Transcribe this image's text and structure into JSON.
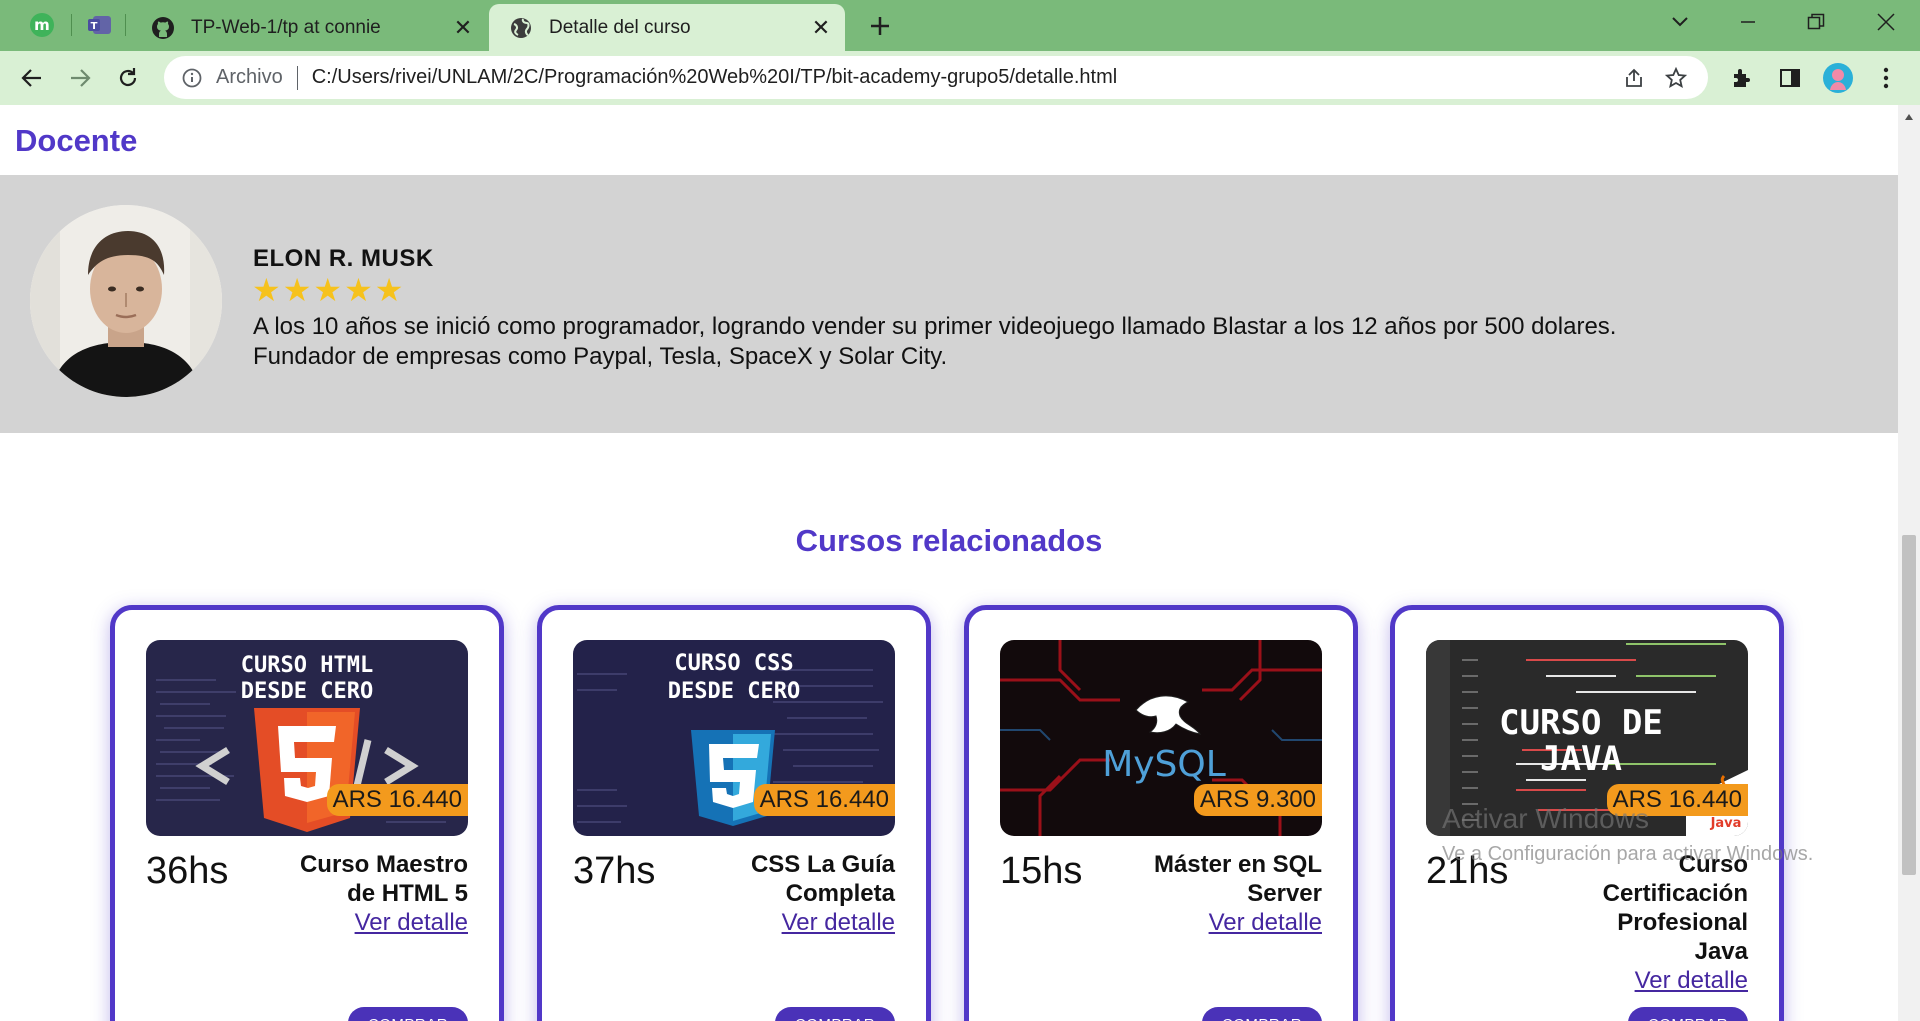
{
  "browser": {
    "pinned_tabs": [
      {
        "icon": "m-letter-icon"
      },
      {
        "icon": "teams-icon"
      }
    ],
    "tabs": [
      {
        "title": "TP-Web-1/tp at connie",
        "icon": "github-icon",
        "close": "✕"
      },
      {
        "title": "Detalle del curso",
        "icon": "globe-icon",
        "close": "✕"
      }
    ],
    "address_bar": {
      "scheme_label": "Archivo",
      "url": "C:/Users/rivei/UNLAM/2C/Programación%20Web%20I/TP/bit-academy-grupo5/detalle.html"
    }
  },
  "page": {
    "docente_heading": "Docente",
    "teacher": {
      "name": "ELON R. MUSK",
      "rating": 5,
      "bio_line1": "A los 10 años se inició como programador, logrando vender su primer videojuego llamado Blastar a los 12 años por 500 dolares.",
      "bio_line2": "Fundador de empresas como Paypal, Tesla, SpaceX y Solar City."
    },
    "related_title": "Cursos relacionados",
    "courses": [
      {
        "hours": "36hs",
        "name": "Curso Maestro de HTML 5",
        "price": "ARS 16.440",
        "image_text": [
          "CURSO HTML",
          "DESDE CERO"
        ],
        "link": "Ver detalle",
        "button": "COMPRAR"
      },
      {
        "hours": "37hs",
        "name": "CSS La Guía Completa",
        "price": "ARS 16.440",
        "image_text": [
          "CURSO CSS",
          "DESDE CERO"
        ],
        "link": "Ver detalle",
        "button": "COMPRAR"
      },
      {
        "hours": "15hs",
        "name": "Máster en SQL Server",
        "price": "ARS 9.300",
        "image_text": [
          "MySQL"
        ],
        "link": "Ver detalle",
        "button": "COMPRAR"
      },
      {
        "hours": "21hs",
        "name": "Curso Certificación Profesional Java",
        "price": "ARS 16.440",
        "image_text": [
          "CURSO DE",
          "JAVA",
          "Java"
        ],
        "link": "Ver detalle",
        "button": "COMPRAR"
      }
    ]
  },
  "watermark": {
    "line1": "Activar Windows",
    "line2": "Ve a Configuración para activar Windows."
  },
  "colors": {
    "tabstrip": "#7aba7a",
    "toolbar": "#d9f0d4",
    "accent": "#5138c8",
    "price_badge": "#f39a1d",
    "teacher_band": "#d3d3d3"
  }
}
